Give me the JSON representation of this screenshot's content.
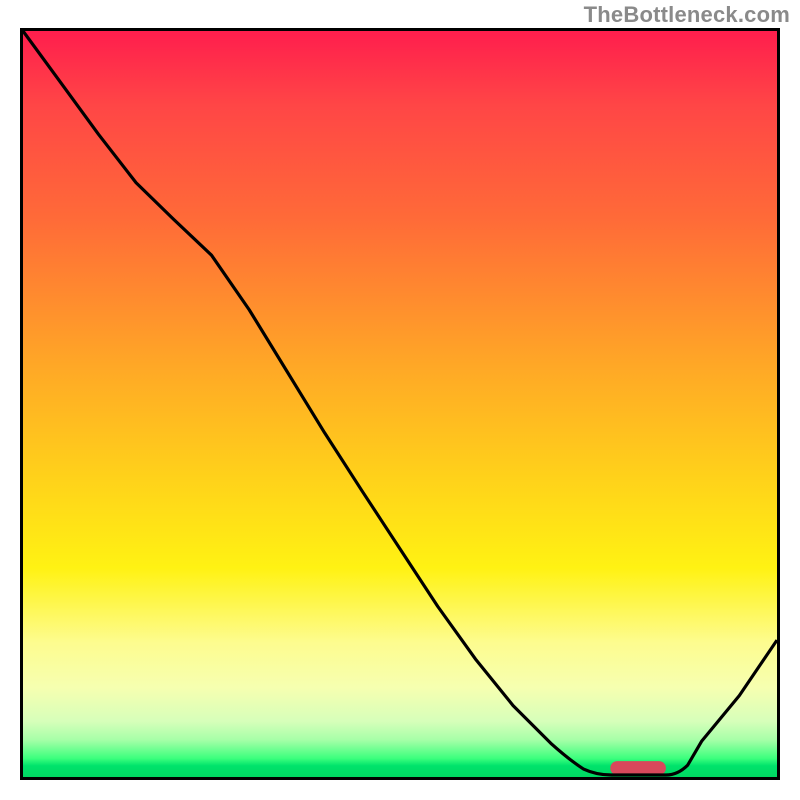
{
  "attribution": "TheBottleneck.com",
  "colors": {
    "gradient_top": "#ff1e4d",
    "gradient_mid1": "#ffa826",
    "gradient_mid2": "#fff213",
    "gradient_bottom": "#00d862",
    "curve": "#000000",
    "frame": "#000000",
    "marker": "#d9485b"
  },
  "chart_data": {
    "type": "line",
    "title": "",
    "xlabel": "",
    "ylabel": "",
    "xlim": [
      0,
      1
    ],
    "ylim": [
      0,
      1
    ],
    "x": [
      0.0,
      0.05,
      0.1,
      0.15,
      0.2,
      0.25,
      0.3,
      0.35,
      0.4,
      0.45,
      0.5,
      0.55,
      0.6,
      0.65,
      0.7,
      0.74,
      0.78,
      0.82,
      0.86,
      0.9,
      0.95,
      1.0
    ],
    "values": [
      1.0,
      0.93,
      0.86,
      0.8,
      0.75,
      0.72,
      0.63,
      0.54,
      0.46,
      0.38,
      0.3,
      0.22,
      0.15,
      0.09,
      0.04,
      0.01,
      0.0,
      0.0,
      0.01,
      0.05,
      0.11,
      0.18
    ],
    "optimum_range_x": [
      0.78,
      0.85
    ],
    "note": "Values are read off the plotted curve on a normalized 0–1 axis in both directions; the curve descends from top-left, reaches a near-zero flat around x≈0.78–0.85 (where the rounded marker sits), then rises toward the right edge. No tick labels are rendered in the image."
  }
}
